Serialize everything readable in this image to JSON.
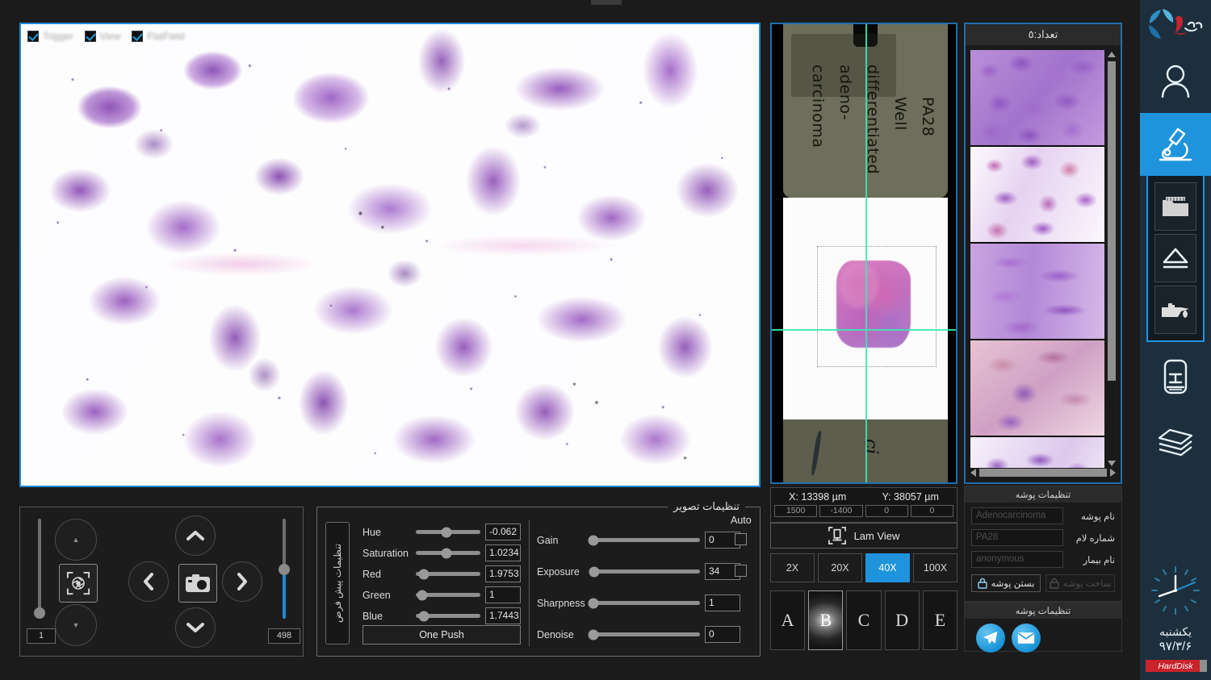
{
  "live_view": {
    "overlay_checks": [
      {
        "label": "Trigger",
        "checked": true
      },
      {
        "label": "View",
        "checked": true
      },
      {
        "label": "FlatField",
        "checked": true
      }
    ]
  },
  "stage_panel": {
    "focus_slider_value": "1",
    "zoom_slider_value": "498",
    "icons": {
      "focus_up": "chevron-up-small-icon",
      "focus_down": "chevron-down-small-icon",
      "aperture": "aperture-focus-icon",
      "move_up": "chevron-up-icon",
      "move_down": "chevron-down-icon",
      "move_left": "chevron-left-icon",
      "move_right": "chevron-right-icon",
      "capture": "camera-icon"
    }
  },
  "image_settings": {
    "title": "تنظیمات تصویر",
    "preset_vertical_label": "تنظیمات پیش فرض",
    "one_push_label": "One Push",
    "auto_label": "Auto",
    "color_sliders": [
      {
        "label": "Hue",
        "value": "-0.062",
        "pos": 48
      },
      {
        "label": "Saturation",
        "value": "1.0234",
        "pos": 48
      },
      {
        "label": "Red",
        "value": "1.9753",
        "pos": 13
      },
      {
        "label": "Green",
        "value": "1",
        "pos": 10
      },
      {
        "label": "Blue",
        "value": "1.7443",
        "pos": 12
      }
    ],
    "camera_sliders": [
      {
        "label": "Gain",
        "value": "0",
        "pos": 3,
        "auto": true,
        "auto_checked": false
      },
      {
        "label": "Exposure",
        "value": "34",
        "pos": 4,
        "auto": true,
        "auto_checked": false
      },
      {
        "label": "Sharpness",
        "value": "1",
        "pos": 3,
        "auto": false,
        "auto_checked": false
      },
      {
        "label": "Denoise",
        "value": "0",
        "pos": 3,
        "auto": false,
        "auto_checked": false
      }
    ]
  },
  "macro_view": {
    "slide_label_lines": [
      "PA28",
      "Well",
      "differentiated",
      "adeno-",
      "carcinoma"
    ],
    "bottom_mark": "ci"
  },
  "coords": {
    "x_label": "X:",
    "x_value": "13398 µm",
    "y_label": "Y:",
    "y_value": "38057 µm",
    "fields": [
      "1500",
      "-1400",
      "0",
      "0"
    ]
  },
  "nav": {
    "lam_view_label": "Lam View",
    "lam_view_icon": "lam-view-icon",
    "magnifications": [
      {
        "label": "2X",
        "active": false
      },
      {
        "label": "20X",
        "active": false
      },
      {
        "label": "40X",
        "active": true
      },
      {
        "label": "100X",
        "active": false
      }
    ],
    "letters": [
      {
        "label": "A",
        "selected": false
      },
      {
        "label": "B",
        "selected": true
      },
      {
        "label": "C",
        "selected": false
      },
      {
        "label": "D",
        "selected": false
      },
      {
        "label": "E",
        "selected": false
      }
    ]
  },
  "thumbnails": {
    "header": "تعداد:٥",
    "items": [
      {
        "cls": "t1"
      },
      {
        "cls": "t2"
      },
      {
        "cls": "t3"
      },
      {
        "cls": "t4"
      },
      {
        "cls": "t5"
      }
    ]
  },
  "folder_settings": {
    "header": "تنظیمات پوشه",
    "fields": [
      {
        "label": "نام پوشه",
        "value": "Adenocarcinoma"
      },
      {
        "label": "شماره لام",
        "value": "PA28"
      },
      {
        "label": "نام بیمار",
        "value": "anonymous"
      }
    ],
    "buttons": [
      {
        "label": "ساخت پوشه",
        "icon": "lock-icon",
        "enabled": false
      },
      {
        "label": "بستن پوشه",
        "icon": "lock-icon",
        "enabled": true
      }
    ]
  },
  "share_panel": {
    "header": "تنظیمات پوشه",
    "buttons": [
      {
        "name": "telegram-icon"
      },
      {
        "name": "email-icon"
      }
    ]
  },
  "sidebar": {
    "logo_name": "app-logo",
    "items": [
      {
        "name": "user-icon",
        "active": false
      },
      {
        "name": "microscope-icon",
        "active": true
      }
    ],
    "sub_items": [
      {
        "name": "folder-icon"
      },
      {
        "name": "eject-icon"
      },
      {
        "name": "oil-can-icon"
      }
    ],
    "lower_items": [
      {
        "name": "slide-cassette-icon"
      },
      {
        "name": "layers-icon"
      }
    ],
    "clock": {
      "icon": "analog-clock-icon",
      "day": "یکشنبه",
      "date": "۹۷/۳/۶"
    },
    "storage_badge": "HardDisk"
  },
  "colors": {
    "accent": "#1f94dd",
    "panel_border": "#1f6fae",
    "sidebar_bg": "#1d2f3c",
    "badge_red": "#c9232b",
    "crosshair": "#3ce8b2"
  }
}
